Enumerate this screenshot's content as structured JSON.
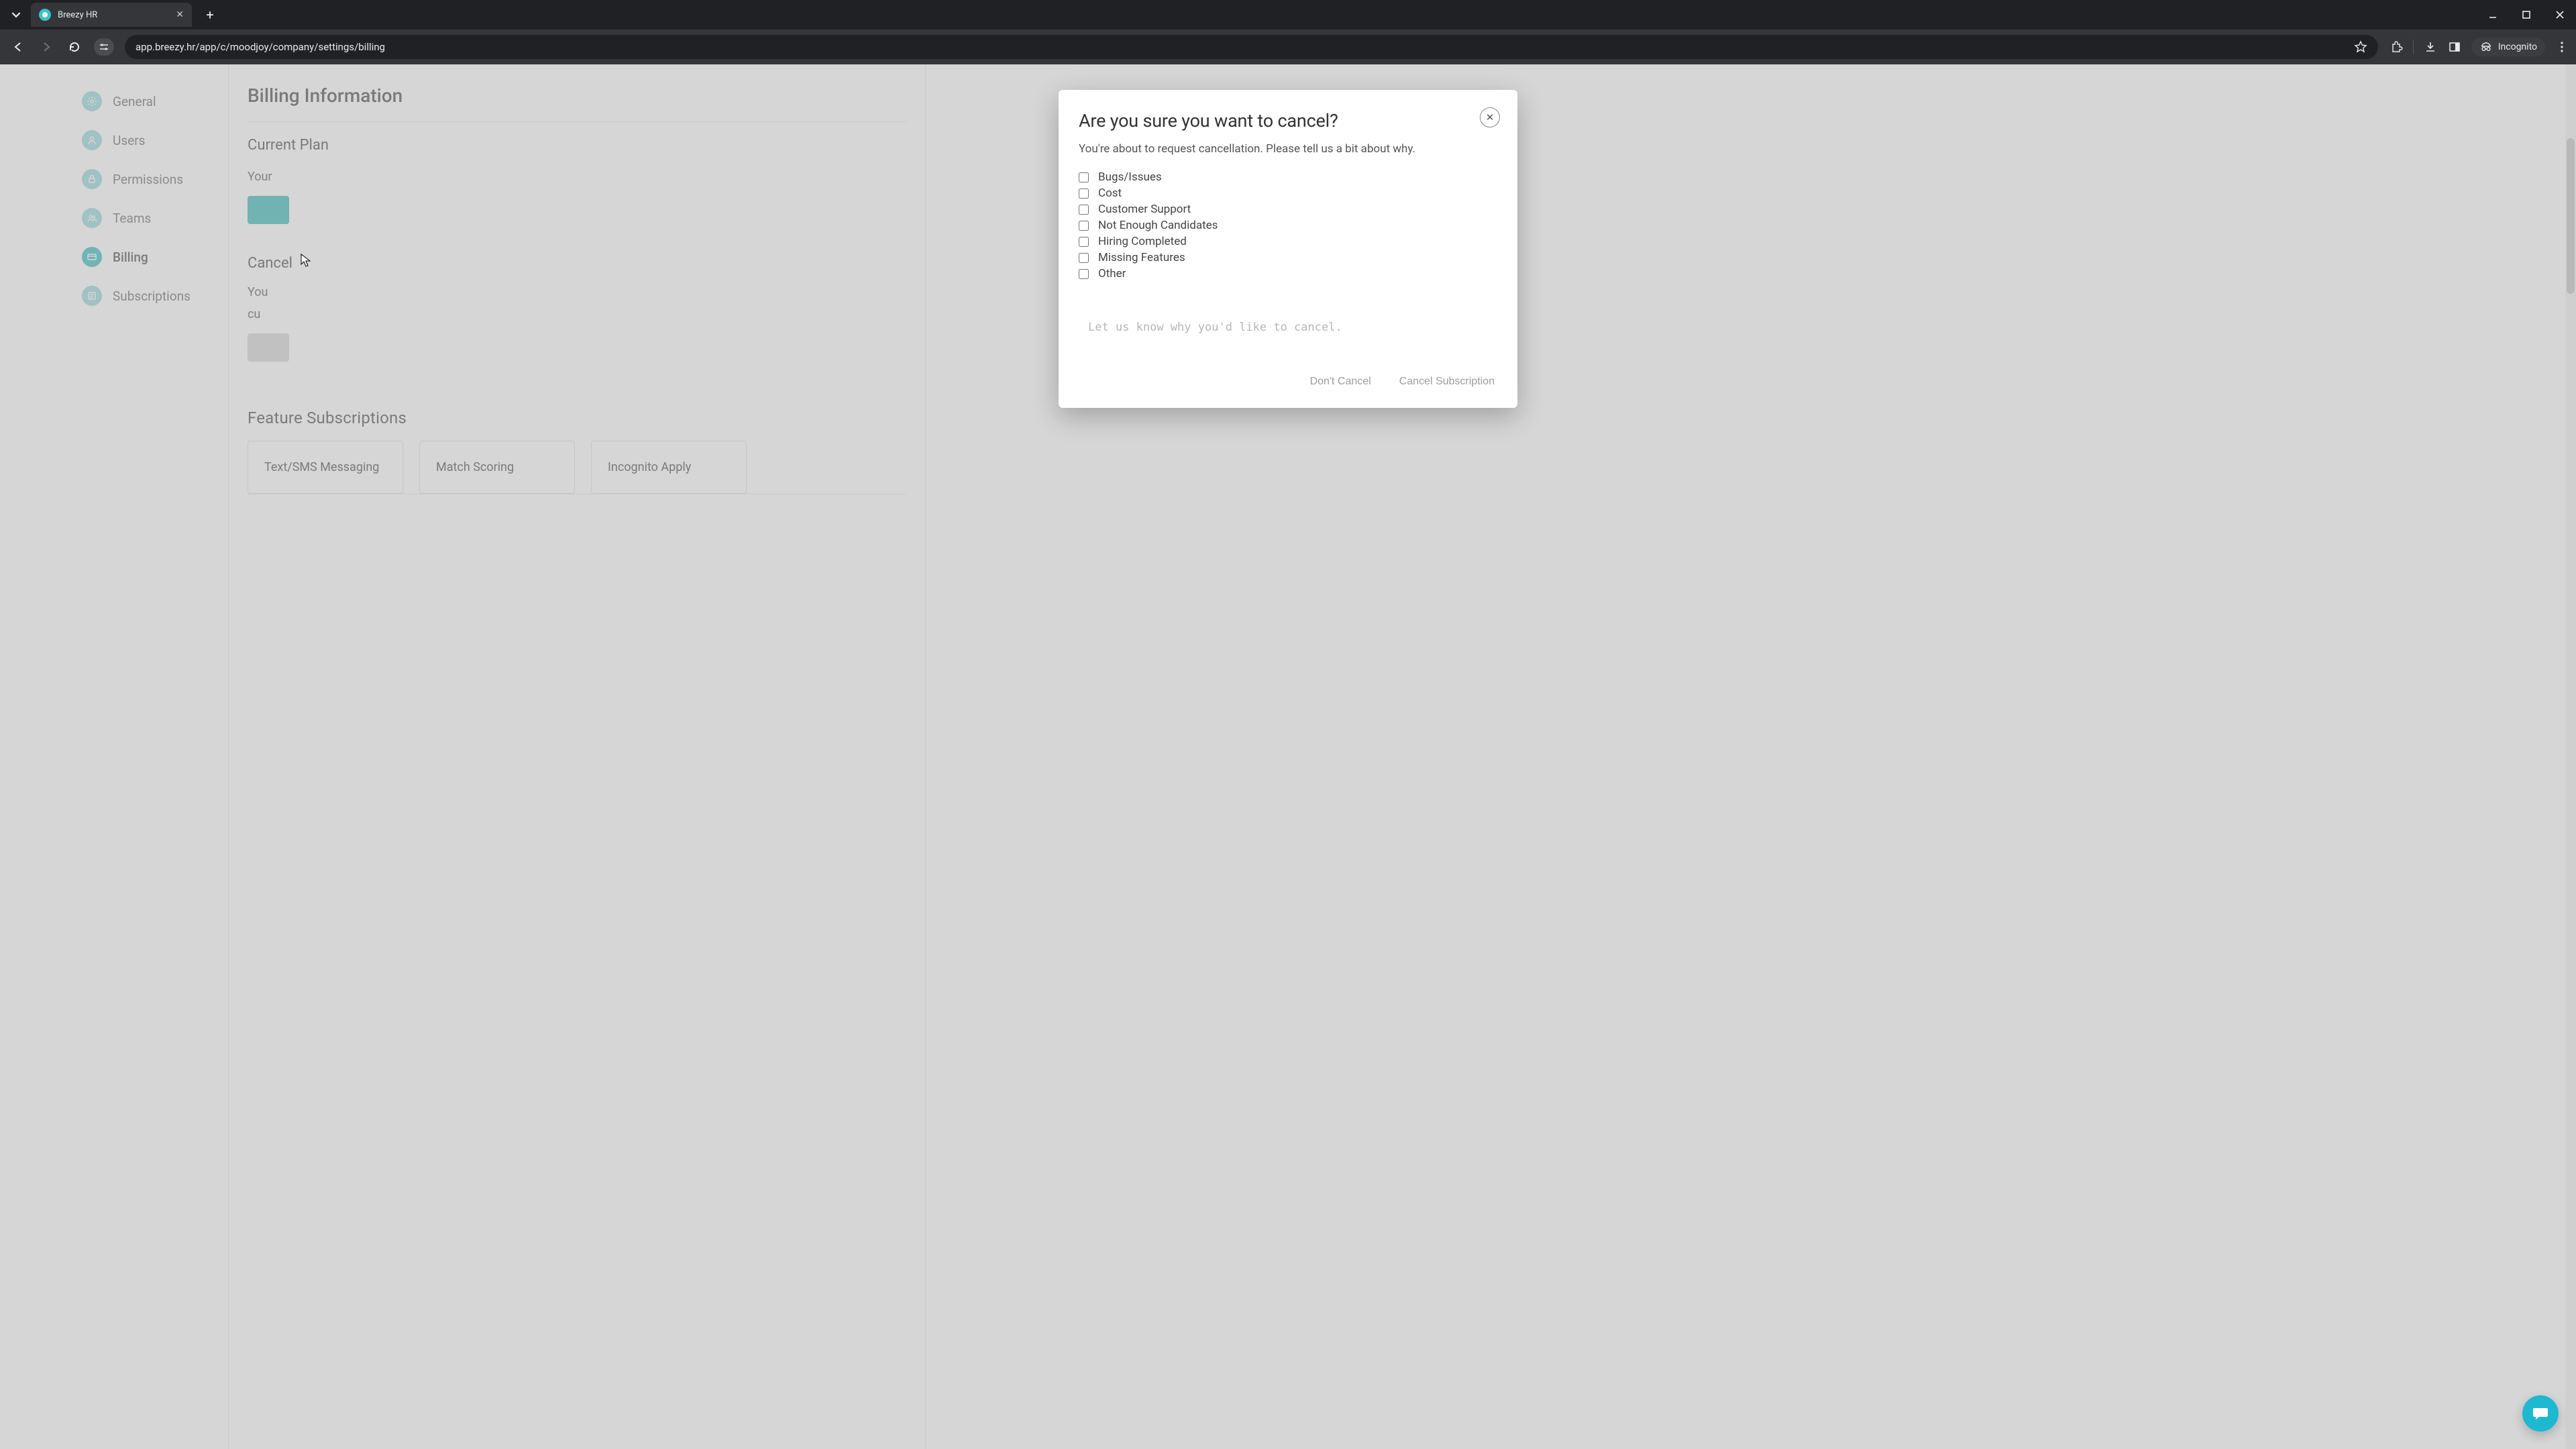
{
  "browser": {
    "tab_title": "Breezy HR",
    "url": "app.breezy.hr/app/c/moodjoy/company/settings/billing",
    "incognito_label": "Incognito"
  },
  "sidebar": {
    "items": [
      {
        "label": "General"
      },
      {
        "label": "Users"
      },
      {
        "label": "Permissions"
      },
      {
        "label": "Teams"
      },
      {
        "label": "Billing"
      },
      {
        "label": "Subscriptions"
      }
    ]
  },
  "page": {
    "billing_heading_partial": "Billing Information",
    "current_plan_partial": "Current Plan",
    "your_plan_partial": "Your",
    "cancel_heading_partial": "Cancel",
    "cancel_body_line1_partial": "You",
    "cancel_body_line2_partial": "cu",
    "feature_heading": "Feature Subscriptions",
    "feature_cards": [
      {
        "label": "Text/SMS Messaging"
      },
      {
        "label": "Match Scoring"
      },
      {
        "label": "Incognito Apply"
      }
    ]
  },
  "modal": {
    "title": "Are you sure you want to cancel?",
    "subtitle": "You're about to request cancellation. Please tell us a bit about why.",
    "reasons": [
      "Bugs/Issues",
      "Cost",
      "Customer Support",
      "Not Enough Candidates",
      "Hiring Completed",
      "Missing Features",
      "Other"
    ],
    "comment_placeholder": "Let us know why you'd like to cancel.",
    "dont_cancel": "Don't Cancel",
    "cancel_sub": "Cancel Subscription"
  }
}
